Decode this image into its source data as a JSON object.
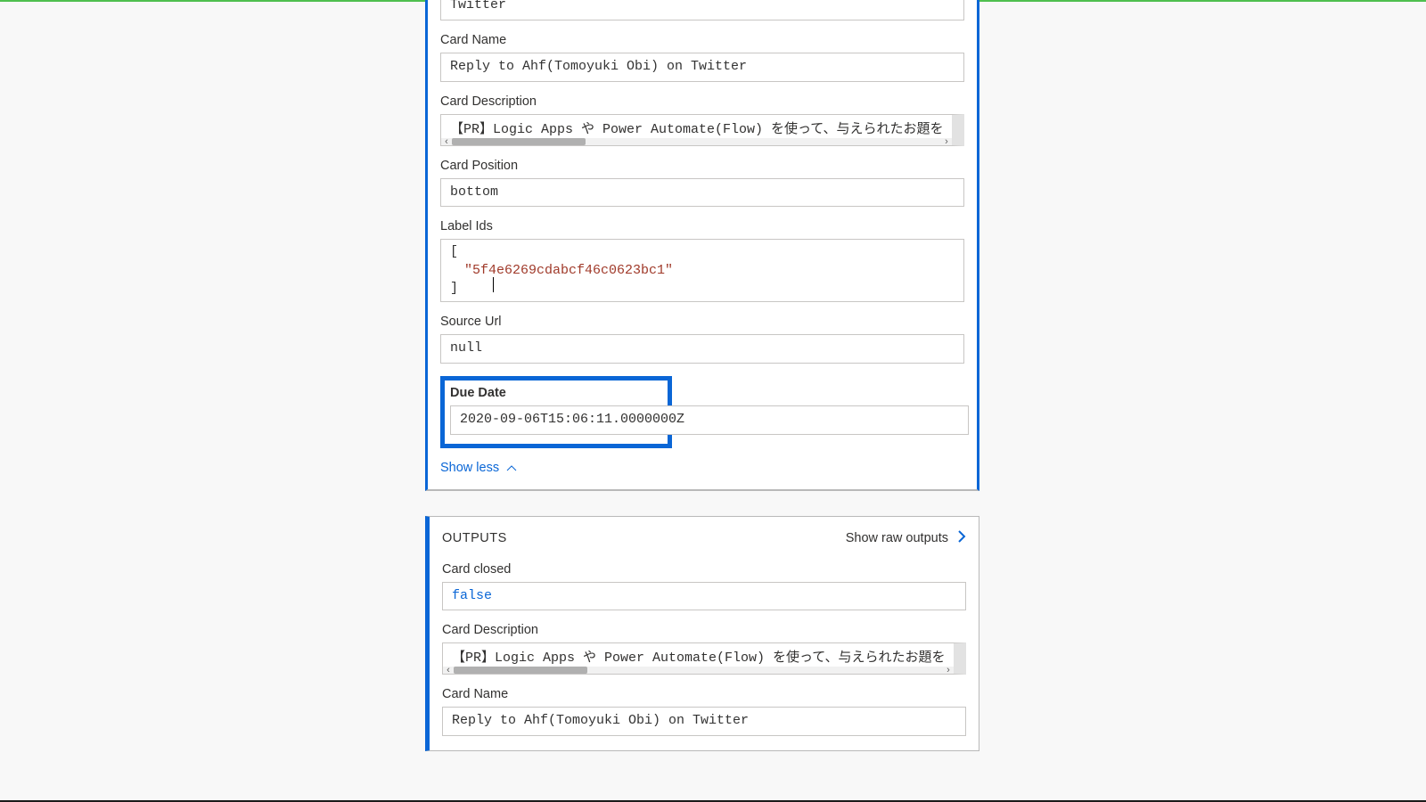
{
  "inputs": {
    "list": {
      "value": "Twitter"
    },
    "cardName": {
      "label": "Card Name",
      "value": "Reply to Ahf(Tomoyuki Obi) on Twitter"
    },
    "cardDescription": {
      "label": "Card Description",
      "value": "【PR】Logic Apps や Power Automate(Flow) を使って、与えられたお題を"
    },
    "cardPosition": {
      "label": "Card Position",
      "value": "bottom"
    },
    "labelIds": {
      "label": "Label Ids",
      "open": "[",
      "string": "\"5f4e6269cdabcf46c0623bc1\"",
      "close": "]"
    },
    "sourceUrl": {
      "label": "Source Url",
      "value": "null"
    },
    "dueDate": {
      "label": "Due Date",
      "value": "2020-09-06T15:06:11.0000000Z"
    },
    "showLess": "Show less"
  },
  "outputs": {
    "heading": "OUTPUTS",
    "rawLink": "Show raw outputs",
    "cardClosed": {
      "label": "Card closed",
      "value": "false"
    },
    "cardDescription": {
      "label": "Card Description",
      "value": "【PR】Logic Apps や Power Automate(Flow) を使って、与えられたお題を"
    },
    "cardName": {
      "label": "Card Name",
      "value": "Reply to Ahf(Tomoyuki Obi) on Twitter"
    }
  }
}
